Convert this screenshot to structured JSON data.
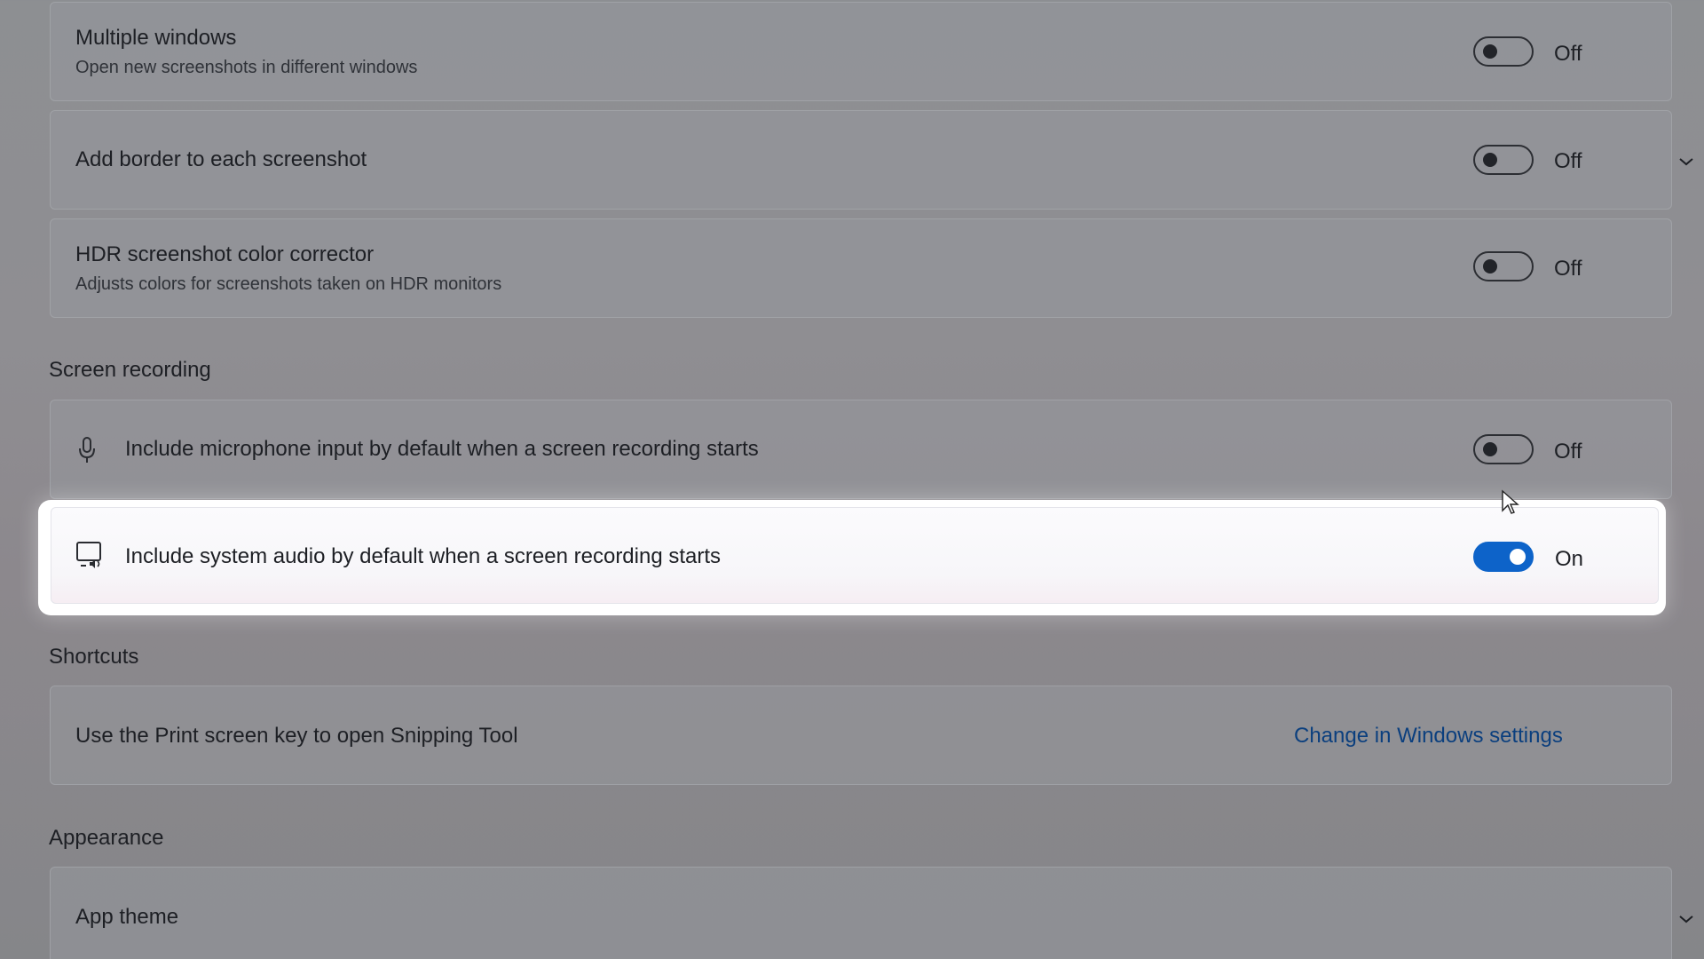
{
  "screenshot": {
    "multiple_windows": {
      "title": "Multiple windows",
      "description": "Open new screenshots in different windows",
      "state": "Off"
    },
    "add_border": {
      "title": "Add border to each screenshot",
      "state": "Off"
    },
    "hdr": {
      "title": "HDR screenshot color corrector",
      "description": "Adjusts colors for screenshots taken on HDR monitors",
      "state": "Off"
    }
  },
  "screen_recording": {
    "header": "Screen recording",
    "microphone": {
      "title": "Include microphone input by default when a screen recording starts",
      "state": "Off",
      "icon": "microphone-icon"
    },
    "system_audio": {
      "title": "Include system audio by default when a screen recording starts",
      "state": "On",
      "icon": "system-audio-icon"
    }
  },
  "shortcuts": {
    "header": "Shortcuts",
    "print_screen": {
      "title": "Use the Print screen key to open Snipping Tool",
      "link": "Change in Windows settings"
    }
  },
  "appearance": {
    "header": "Appearance",
    "app_theme": {
      "title": "App theme"
    }
  },
  "colors": {
    "accent": "#0d63c9",
    "link": "#0b3f7e"
  }
}
